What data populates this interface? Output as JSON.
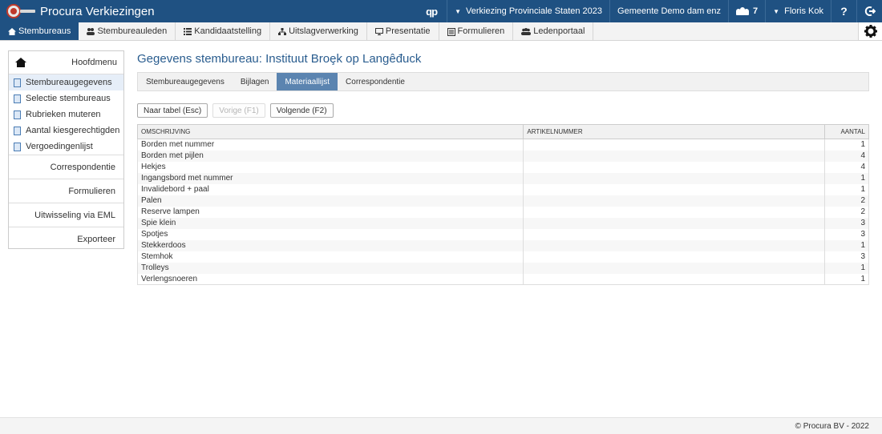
{
  "app": {
    "title": "Procura Verkiezingen",
    "brand_color": "#1f5182",
    "accent_color": "#c0392b"
  },
  "topbar": {
    "qp_label": "qp",
    "election": "Verkiezing Provinciale Staten 2023",
    "municipality": "Gemeente Demo dam enz",
    "users_count": "7",
    "user": "Floris Kok",
    "help_label": "?",
    "logout_icon": "logout-arrow-icon"
  },
  "nav": {
    "items": [
      {
        "label": "Stembureaus",
        "icon": "home-icon"
      },
      {
        "label": "Stembureauleden",
        "icon": "people-icon"
      },
      {
        "label": "Kandidaatstelling",
        "icon": "list-icon"
      },
      {
        "label": "Uitslagverwerking",
        "icon": "sitemap-icon"
      },
      {
        "label": "Presentatie",
        "icon": "monitor-icon"
      },
      {
        "label": "Formulieren",
        "icon": "form-icon"
      },
      {
        "label": "Ledenportaal",
        "icon": "group-icon"
      }
    ],
    "active": "Stembureaus"
  },
  "sidebar": {
    "home_label": "Hoofdmenu",
    "links": [
      {
        "label": "Stembureaugegevens"
      },
      {
        "label": "Selectie stembureaus"
      },
      {
        "label": "Rubrieken muteren"
      },
      {
        "label": "Aantal kiesgerechtigden"
      },
      {
        "label": "Vergoedingenlijst"
      }
    ],
    "sections": [
      {
        "label": "Correspondentie"
      },
      {
        "label": "Formulieren"
      },
      {
        "label": "Uitwisseling via EML"
      },
      {
        "label": "Exporteer"
      }
    ]
  },
  "main": {
    "title": "Gegevens stembureau: Instituut Broȩk op Langêđuck",
    "tabs": [
      {
        "label": "Stembureaugegevens"
      },
      {
        "label": "Bijlagen"
      },
      {
        "label": "Materiaallijst"
      },
      {
        "label": "Correspondentie"
      }
    ],
    "active_tab": "Materiaallijst",
    "buttons": {
      "back": "Naar tabel (Esc)",
      "prev": "Vorige (F1)",
      "next": "Volgende (F2)"
    },
    "table": {
      "headers": [
        "OMSCHRIJVING",
        "ARTIKELNUMMER",
        "AANTAL"
      ],
      "rows": [
        {
          "omschrijving": "Borden met nummer",
          "artikelnummer": "",
          "aantal": "1"
        },
        {
          "omschrijving": "Borden met pijlen",
          "artikelnummer": "",
          "aantal": "4"
        },
        {
          "omschrijving": "Hekjes",
          "artikelnummer": "",
          "aantal": "4"
        },
        {
          "omschrijving": "Ingangsbord met nummer",
          "artikelnummer": "",
          "aantal": "1"
        },
        {
          "omschrijving": "Invalidebord + paal",
          "artikelnummer": "",
          "aantal": "1"
        },
        {
          "omschrijving": "Palen",
          "artikelnummer": "",
          "aantal": "2"
        },
        {
          "omschrijving": "Reserve lampen",
          "artikelnummer": "",
          "aantal": "2"
        },
        {
          "omschrijving": "Spie klein",
          "artikelnummer": "",
          "aantal": "3"
        },
        {
          "omschrijving": "Spotjes",
          "artikelnummer": "",
          "aantal": "3"
        },
        {
          "omschrijving": "Stekkerdoos",
          "artikelnummer": "",
          "aantal": "1"
        },
        {
          "omschrijving": "Stemhok",
          "artikelnummer": "",
          "aantal": "3"
        },
        {
          "omschrijving": "Trolleys",
          "artikelnummer": "",
          "aantal": "1"
        },
        {
          "omschrijving": "Verlengsnoeren",
          "artikelnummer": "",
          "aantal": "1"
        }
      ]
    }
  },
  "footer": {
    "copyright": "© Procura BV - 2022"
  }
}
